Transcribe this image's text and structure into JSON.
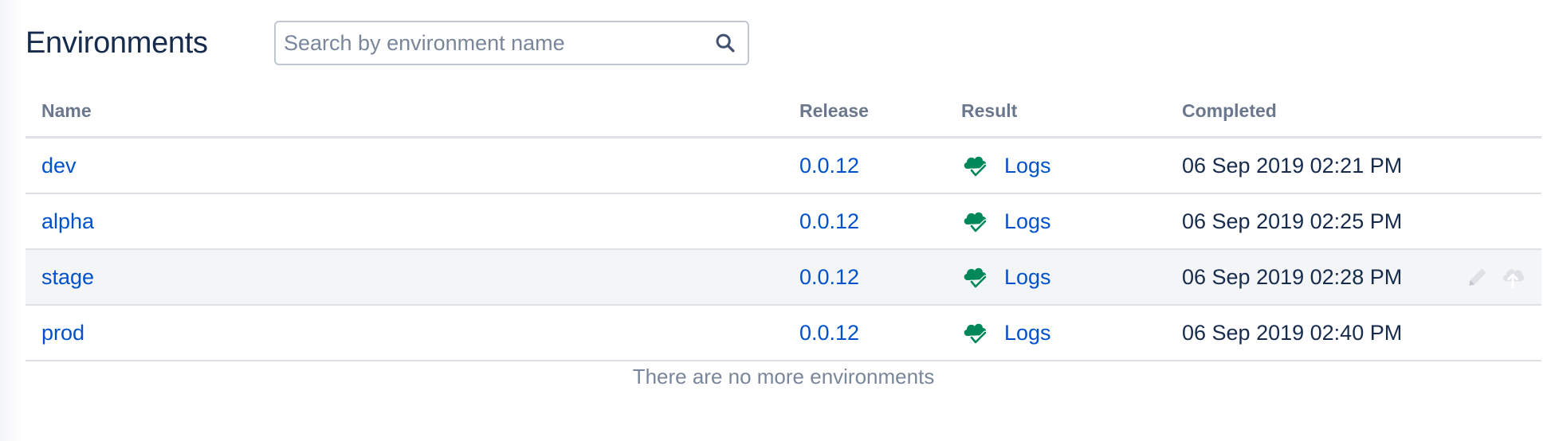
{
  "header": {
    "title": "Environments"
  },
  "search": {
    "placeholder": "Search by environment name",
    "value": ""
  },
  "table": {
    "columns": {
      "name": "Name",
      "release": "Release",
      "result": "Result",
      "completed": "Completed"
    },
    "rows": [
      {
        "name": "dev",
        "release": "0.0.12",
        "result_icon": "cloud-deploy-success-icon",
        "result_link": "Logs",
        "completed": "06 Sep 2019 02:21 PM"
      },
      {
        "name": "alpha",
        "release": "0.0.12",
        "result_icon": "cloud-deploy-success-icon",
        "result_link": "Logs",
        "completed": "06 Sep 2019 02:25 PM"
      },
      {
        "name": "stage",
        "release": "0.0.12",
        "result_icon": "cloud-deploy-success-icon",
        "result_link": "Logs",
        "completed": "06 Sep 2019 02:28 PM",
        "hovered": true,
        "actions": [
          "pencil-icon",
          "cloud-upload-icon"
        ]
      },
      {
        "name": "prod",
        "release": "0.0.12",
        "result_icon": "cloud-deploy-success-icon",
        "result_link": "Logs",
        "completed": "06 Sep 2019 02:40 PM"
      }
    ],
    "footer": "There are no more environments"
  },
  "colors": {
    "link": "#0052cc",
    "success": "#00875a",
    "header_text": "#6b778c",
    "muted": "#7a869a",
    "hover_row": "#f4f5f7"
  }
}
